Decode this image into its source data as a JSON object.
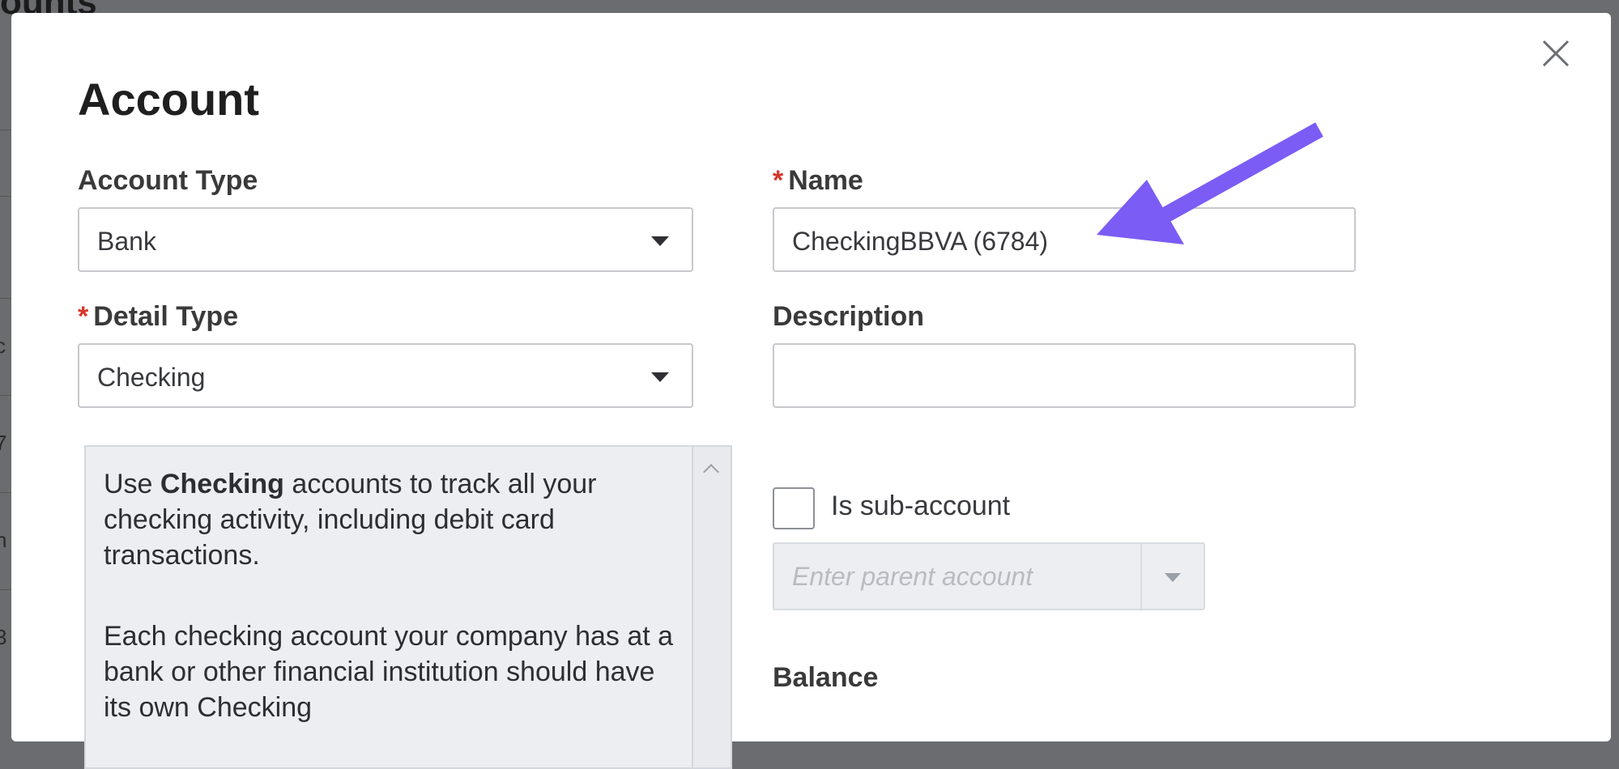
{
  "background": {
    "heading_fragment": "ounts",
    "row_fragments": [
      "c",
      "7",
      "n",
      "3"
    ]
  },
  "modal": {
    "title": "Account",
    "account_type": {
      "label": "Account Type",
      "value": "Bank"
    },
    "detail_type": {
      "label": "Detail Type",
      "value": "Checking",
      "required_mark": "*"
    },
    "name": {
      "label": "Name",
      "value": "CheckingBBVA (6784)",
      "required_mark": "*"
    },
    "description": {
      "label": "Description",
      "value": ""
    },
    "help": {
      "p1_prefix": "Use ",
      "p1_bold": "Checking",
      "p1_suffix": " accounts to track all your checking activity, including debit card transactions.",
      "p2": "Each checking account your company has at a bank or other financial institution should have its own Checking"
    },
    "sub_account": {
      "label": "Is sub-account",
      "checked": false,
      "parent_placeholder": "Enter parent account"
    },
    "balance": {
      "label": "Balance"
    }
  },
  "colors": {
    "required": "#d6362a",
    "annotation_arrow": "#7b5cf5"
  }
}
